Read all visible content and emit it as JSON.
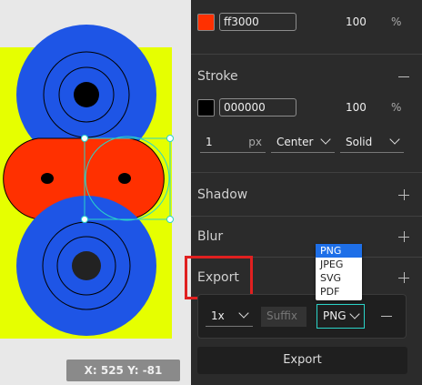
{
  "canvas": {
    "coords_text": "X: 525 Y: -81",
    "colors": {
      "background": "#e6ff00",
      "blue": "#1e55e6",
      "red": "#ff3000",
      "selection": "#2bd4c8"
    }
  },
  "fill": {
    "hex": "ff3000",
    "color": "#ff3000",
    "opacity": "100",
    "unit": "%"
  },
  "stroke": {
    "title": "Stroke",
    "hex": "000000",
    "color": "#000000",
    "opacity": "100",
    "unit": "%",
    "width": "1",
    "width_unit": "px",
    "align": "Center",
    "style": "Solid"
  },
  "sections": {
    "shadow": "Shadow",
    "blur": "Blur",
    "export": "Export"
  },
  "export": {
    "scale": "1x",
    "suffix_placeholder": "Suffix",
    "format": "PNG",
    "formats": [
      "PNG",
      "JPEG",
      "SVG",
      "PDF"
    ],
    "button_label": "Export"
  }
}
